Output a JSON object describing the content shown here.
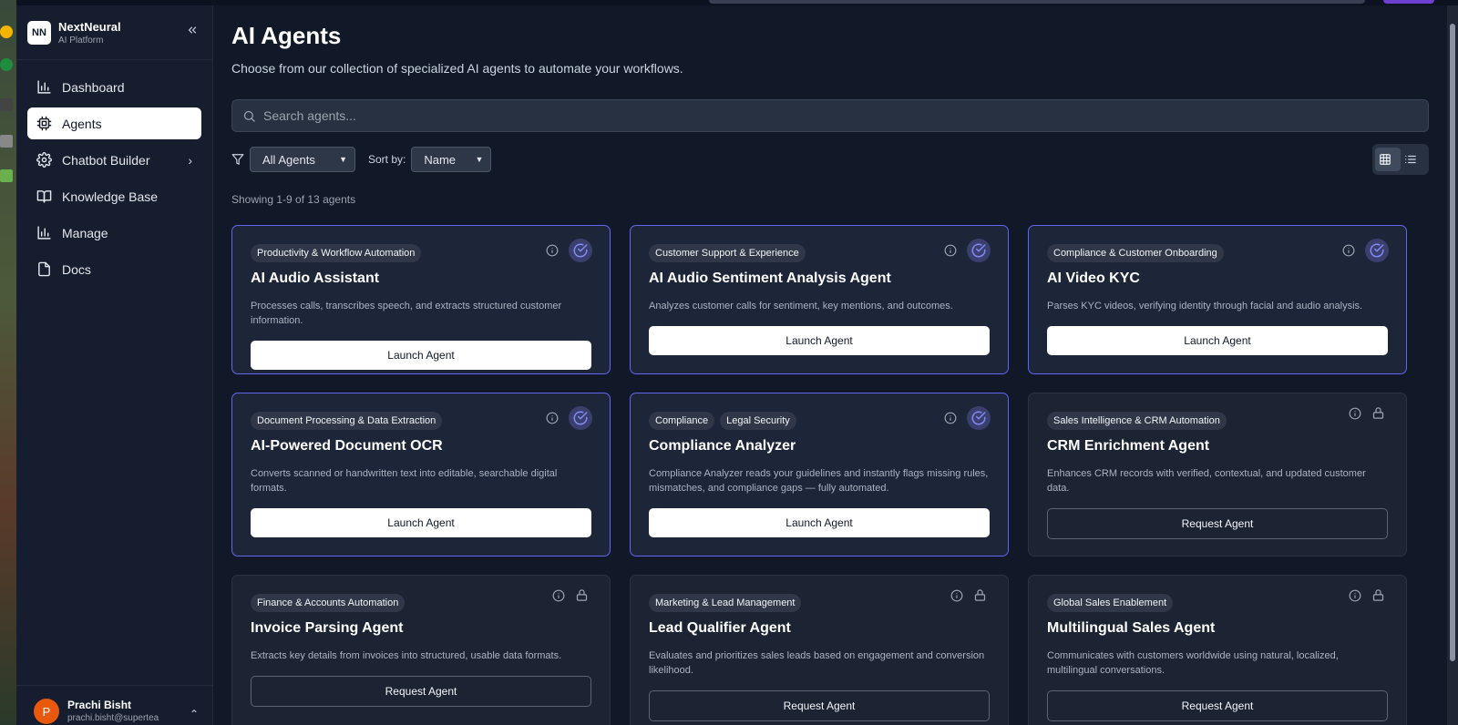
{
  "brand": {
    "logo": "NN",
    "name": "NextNeural",
    "subtitle": "AI Platform"
  },
  "sidebar": {
    "collapse_icon": "chevrons-left-icon",
    "items": [
      {
        "label": "Dashboard",
        "icon": "bar-chart-icon",
        "active": false
      },
      {
        "label": "Agents",
        "icon": "cpu-icon",
        "active": true
      },
      {
        "label": "Chatbot Builder",
        "icon": "gear-icon",
        "active": false,
        "has_submenu": true
      },
      {
        "label": "Knowledge Base",
        "icon": "book-icon",
        "active": false
      },
      {
        "label": "Manage",
        "icon": "bar-chart-icon",
        "active": false
      },
      {
        "label": "Docs",
        "icon": "file-icon",
        "active": false
      }
    ]
  },
  "user": {
    "initial": "P",
    "name": "Prachi Bisht",
    "email": "prachi.bisht@supertea"
  },
  "page": {
    "title": "AI Agents",
    "subtitle": "Choose from our collection of specialized AI agents to automate your workflows."
  },
  "search": {
    "placeholder": "Search agents...",
    "value": ""
  },
  "filters": {
    "category_selected": "All Agents",
    "sort_label": "Sort by:",
    "sort_selected": "Name"
  },
  "view": {
    "grid_active": true
  },
  "showing_text": "Showing 1-9 of 13 agents",
  "colors": {
    "accent": "#6366f1",
    "background": "#111827",
    "card": "#1c2434"
  },
  "agents": [
    {
      "tags": [
        "Productivity & Workflow Automation"
      ],
      "title": "AI Audio Assistant",
      "description": "Processes calls, transcribes speech, and extracts structured customer information.",
      "enabled": true,
      "button": "Launch Agent"
    },
    {
      "tags": [
        "Customer Support & Experience"
      ],
      "title": "AI Audio Sentiment Analysis Agent",
      "description": "Analyzes customer calls for sentiment, key mentions, and outcomes.",
      "enabled": true,
      "button": "Launch Agent"
    },
    {
      "tags": [
        "Compliance & Customer Onboarding"
      ],
      "title": "AI Video KYC",
      "description": "Parses KYC videos, verifying identity through facial and audio analysis.",
      "enabled": true,
      "button": "Launch Agent"
    },
    {
      "tags": [
        "Document Processing & Data Extraction"
      ],
      "title": "AI-Powered Document OCR",
      "description": "Converts scanned or handwritten text into editable, searchable digital formats.",
      "enabled": true,
      "button": "Launch Agent"
    },
    {
      "tags": [
        "Compliance",
        "Legal Security"
      ],
      "title": "Compliance Analyzer",
      "description": "Compliance Analyzer reads your guidelines and instantly flags missing rules, mismatches, and compliance gaps — fully automated.",
      "enabled": true,
      "button": "Launch Agent"
    },
    {
      "tags": [
        "Sales Intelligence & CRM Automation"
      ],
      "title": "CRM Enrichment Agent",
      "description": "Enhances CRM records with verified, contextual, and updated customer data.",
      "enabled": false,
      "button": "Request Agent"
    },
    {
      "tags": [
        "Finance & Accounts Automation"
      ],
      "title": "Invoice Parsing Agent",
      "description": "Extracts key details from invoices into structured, usable data formats.",
      "enabled": false,
      "button": "Request Agent"
    },
    {
      "tags": [
        "Marketing & Lead Management"
      ],
      "title": "Lead Qualifier Agent",
      "description": "Evaluates and prioritizes sales leads based on engagement and conversion likelihood.",
      "enabled": false,
      "button": "Request Agent"
    },
    {
      "tags": [
        "Global Sales Enablement"
      ],
      "title": "Multilingual Sales Agent",
      "description": "Communicates with customers worldwide using natural, localized, multilingual conversations.",
      "enabled": false,
      "button": "Request Agent"
    }
  ]
}
